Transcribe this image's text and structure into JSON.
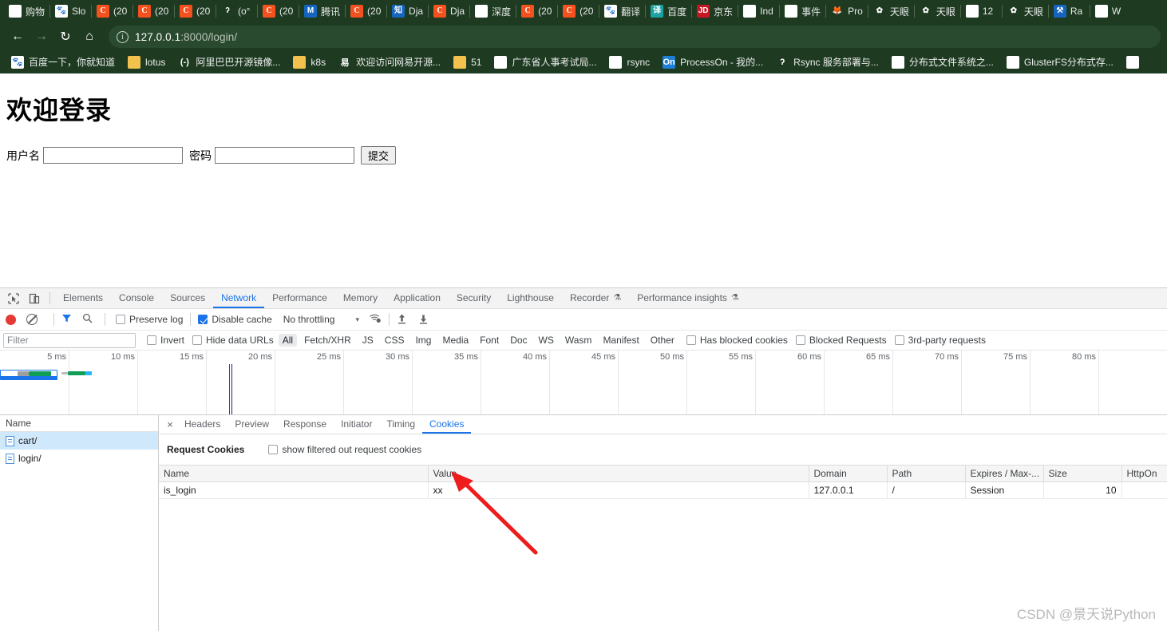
{
  "browser": {
    "tabs": [
      {
        "icon": "globe-icon",
        "icon_class": "fav-globe",
        "glyph": "⊕",
        "title": "购物"
      },
      {
        "icon": "baidu-icon",
        "icon_class": "fav-baidu",
        "glyph": "🐾",
        "title": "Slo"
      },
      {
        "icon": "csdn-icon",
        "icon_class": "fav-c",
        "glyph": "C",
        "title": "(20"
      },
      {
        "icon": "csdn-icon",
        "icon_class": "fav-c",
        "glyph": "C",
        "title": "(20"
      },
      {
        "icon": "csdn-icon",
        "icon_class": "fav-c",
        "glyph": "C",
        "title": "(20"
      },
      {
        "icon": "script-icon",
        "icon_class": "fav-none",
        "glyph": "ʔ",
        "title": "(o°"
      },
      {
        "icon": "csdn-icon",
        "icon_class": "fav-c",
        "glyph": "C",
        "title": "(20"
      },
      {
        "icon": "tencent-icon",
        "icon_class": "fav-blue",
        "glyph": "M",
        "title": "腾讯"
      },
      {
        "icon": "csdn-icon",
        "icon_class": "fav-c",
        "glyph": "C",
        "title": "(20"
      },
      {
        "icon": "zhihu-icon",
        "icon_class": "fav-blue",
        "glyph": "知",
        "title": "Dja"
      },
      {
        "icon": "csdn-icon",
        "icon_class": "fav-c",
        "glyph": "C",
        "title": "Dja"
      },
      {
        "icon": "globe-icon",
        "icon_class": "fav-globe",
        "glyph": "⊕",
        "title": "深度"
      },
      {
        "icon": "csdn-icon",
        "icon_class": "fav-c",
        "glyph": "C",
        "title": "(20"
      },
      {
        "icon": "csdn-icon",
        "icon_class": "fav-c",
        "glyph": "C",
        "title": "(20"
      },
      {
        "icon": "baidu-icon",
        "icon_class": "fav-baidu",
        "glyph": "🐾",
        "title": "翻译"
      },
      {
        "icon": "translate-icon",
        "icon_class": "fav-teal",
        "glyph": "译",
        "title": "百度"
      },
      {
        "icon": "jd-icon",
        "icon_class": "fav-jd",
        "glyph": "JD",
        "title": "京东"
      },
      {
        "icon": "globe-icon",
        "icon_class": "fav-globe",
        "glyph": "⊕",
        "title": "Ind"
      },
      {
        "icon": "globe-icon",
        "icon_class": "fav-globe",
        "glyph": "⊕",
        "title": "事件"
      },
      {
        "icon": "firefox-icon",
        "icon_class": "fav-fire",
        "glyph": "🦊",
        "title": "Pro"
      },
      {
        "icon": "flower-icon",
        "icon_class": "fav-flower",
        "glyph": "✿",
        "title": "天眼"
      },
      {
        "icon": "flower-icon",
        "icon_class": "fav-flower",
        "glyph": "✿",
        "title": "天眼"
      },
      {
        "icon": "globe-icon",
        "icon_class": "fav-globe",
        "glyph": "⊕",
        "title": "12"
      },
      {
        "icon": "flower-icon",
        "icon_class": "fav-flower",
        "glyph": "✿",
        "title": "天眼"
      },
      {
        "icon": "rancher-icon",
        "icon_class": "fav-blue",
        "glyph": "⚒",
        "title": "Ra"
      },
      {
        "icon": "globe-icon",
        "icon_class": "fav-globe",
        "glyph": "⊕",
        "title": "W"
      }
    ],
    "nav": {
      "back": "←",
      "forward": "→",
      "reload": "↻",
      "home": "⌂"
    },
    "omnibox": {
      "info_glyph": "i",
      "url_host": "127.0.0.1",
      "url_rest": ":8000/login/"
    },
    "bookmarks": [
      {
        "icon": "baidu-icon",
        "icon_class": "fav-baidu",
        "glyph": "🐾",
        "label": "百度一下，你就知道"
      },
      {
        "icon": "folder-icon",
        "icon_class": "ic-folder",
        "glyph": "",
        "label": "lotus"
      },
      {
        "icon": "alibaba-icon",
        "icon_class": "ic-ali",
        "glyph": "(-)",
        "label": "阿里巴巴开源镜像..."
      },
      {
        "icon": "folder-icon",
        "icon_class": "ic-folder",
        "glyph": "",
        "label": "k8s"
      },
      {
        "icon": "netease-icon",
        "icon_class": "ic-netease",
        "glyph": "易",
        "label": "欢迎访问网易开源..."
      },
      {
        "icon": "folder-icon",
        "icon_class": "ic-folder",
        "glyph": "",
        "label": "51"
      },
      {
        "icon": "globe-icon",
        "icon_class": "fav-globe",
        "glyph": "⊕",
        "label": "广东省人事考试局..."
      },
      {
        "icon": "globe-icon",
        "icon_class": "fav-globe",
        "glyph": "⊕",
        "label": "rsync"
      },
      {
        "icon": "processon-icon",
        "icon_class": "ic-on",
        "glyph": "On",
        "label": "ProcessOn - 我的..."
      },
      {
        "icon": "script-icon",
        "icon_class": "fav-none",
        "glyph": "ʔ",
        "label": "Rsync 服务部署与..."
      },
      {
        "icon": "globe-icon",
        "icon_class": "fav-globe",
        "glyph": "⊕",
        "label": "分布式文件系统之..."
      },
      {
        "icon": "globe-icon",
        "icon_class": "fav-globe",
        "glyph": "⊕",
        "label": "GlusterFS分布式存..."
      },
      {
        "icon": "globe-icon",
        "icon_class": "fav-globe",
        "glyph": "⊕",
        "label": ""
      }
    ]
  },
  "page": {
    "heading": "欢迎登录",
    "username_label": "用户名",
    "username_value": "",
    "username_placeholder": "",
    "password_label": "密码",
    "password_value": "",
    "password_placeholder": "",
    "submit_label": "提交"
  },
  "devtools": {
    "panels": [
      {
        "label": "Elements",
        "active": false,
        "flask": false
      },
      {
        "label": "Console",
        "active": false,
        "flask": false
      },
      {
        "label": "Sources",
        "active": false,
        "flask": false
      },
      {
        "label": "Network",
        "active": true,
        "flask": false
      },
      {
        "label": "Performance",
        "active": false,
        "flask": false
      },
      {
        "label": "Memory",
        "active": false,
        "flask": false
      },
      {
        "label": "Application",
        "active": false,
        "flask": false
      },
      {
        "label": "Security",
        "active": false,
        "flask": false
      },
      {
        "label": "Lighthouse",
        "active": false,
        "flask": false
      },
      {
        "label": "Recorder",
        "active": false,
        "flask": true
      },
      {
        "label": "Performance insights",
        "active": false,
        "flask": true
      }
    ],
    "flask_glyph": "⚗",
    "toolbar": {
      "record_title": "record-button",
      "preserve_log_label": "Preserve log",
      "preserve_log_checked": false,
      "disable_cache_label": "Disable cache",
      "disable_cache_checked": true,
      "throttling_value": "No throttling",
      "caret_glyph": "▾",
      "wifi_glyph": "ᴘ",
      "import_glyph": "⬆",
      "export_glyph": "⬇",
      "funnel_glyph": "▽",
      "search_glyph": "⚲"
    },
    "filterbar": {
      "filter_placeholder": "Filter",
      "filter_value": "",
      "invert_label": "Invert",
      "invert_checked": false,
      "hide_data_urls_label": "Hide data URLs",
      "hide_data_urls_checked": false,
      "types": [
        {
          "label": "All",
          "active": true
        },
        {
          "label": "Fetch/XHR",
          "active": false
        },
        {
          "label": "JS",
          "active": false
        },
        {
          "label": "CSS",
          "active": false
        },
        {
          "label": "Img",
          "active": false
        },
        {
          "label": "Media",
          "active": false
        },
        {
          "label": "Font",
          "active": false
        },
        {
          "label": "Doc",
          "active": false
        },
        {
          "label": "WS",
          "active": false
        },
        {
          "label": "Wasm",
          "active": false
        },
        {
          "label": "Manifest",
          "active": false
        },
        {
          "label": "Other",
          "active": false
        }
      ],
      "has_blocked_cookies_label": "Has blocked cookies",
      "has_blocked_cookies_checked": false,
      "blocked_requests_label": "Blocked Requests",
      "blocked_requests_checked": false,
      "third_party_label": "3rd-party requests",
      "third_party_checked": false
    },
    "overview": {
      "ticks": [
        "5 ms",
        "10 ms",
        "15 ms",
        "20 ms",
        "25 ms",
        "30 ms",
        "35 ms",
        "40 ms",
        "45 ms",
        "50 ms",
        "55 ms",
        "60 ms",
        "65 ms",
        "70 ms",
        "75 ms",
        "80 ms"
      ]
    },
    "requests": {
      "column_header": "Name",
      "rows": [
        {
          "name": "cart/",
          "selected": true
        },
        {
          "name": "login/",
          "selected": false
        }
      ]
    },
    "detail": {
      "close_glyph": "×",
      "tabs": [
        {
          "label": "Headers",
          "active": false
        },
        {
          "label": "Preview",
          "active": false
        },
        {
          "label": "Response",
          "active": false
        },
        {
          "label": "Initiator",
          "active": false
        },
        {
          "label": "Timing",
          "active": false
        },
        {
          "label": "Cookies",
          "active": true
        }
      ],
      "section_title": "Request Cookies",
      "show_filtered_label": "show filtered out request cookies",
      "show_filtered_checked": false,
      "table": {
        "columns": [
          "Name",
          "Value",
          "Domain",
          "Path",
          "Expires / Max-...",
          "Size",
          "HttpOn"
        ],
        "rows": [
          {
            "name": "is_login",
            "value": "xx",
            "domain": "127.0.0.1",
            "path": "/",
            "expires": "Session",
            "size": "10",
            "httponly": ""
          }
        ]
      }
    }
  },
  "watermark": "CSDN @景天说Python",
  "colors": {
    "chrome_bg": "#1e3b22",
    "accent": "#1a73e8",
    "record_red": "#e53935",
    "selection": "#cfe8fc",
    "annotation_arrow": "#ee1c1c"
  }
}
